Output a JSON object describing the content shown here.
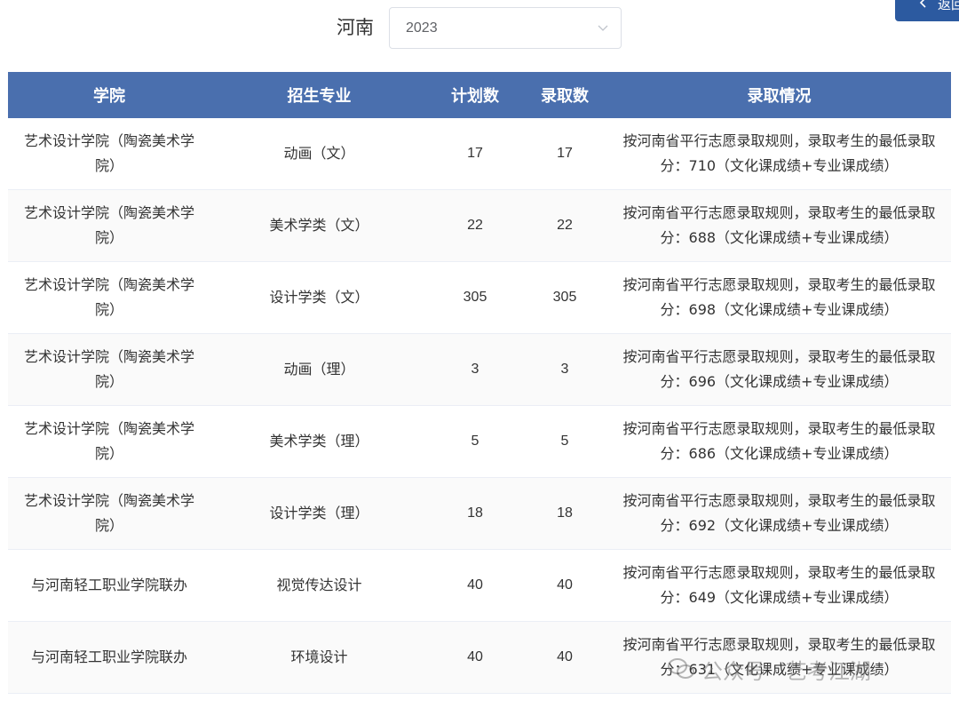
{
  "filter": {
    "province_label": "河南",
    "year_value": "2023"
  },
  "back_button": {
    "label": "返回"
  },
  "table": {
    "headers": {
      "college": "学院",
      "major": "招生专业",
      "plan": "计划数",
      "admitted": "录取数",
      "status": "录取情况"
    },
    "rows": [
      {
        "college": "艺术设计学院（陶瓷美术学院）",
        "major": "动画（文）",
        "plan": "17",
        "admitted": "17",
        "status": "按河南省平行志愿录取规则，录取考生的最低录取分：710（文化课成绩+专业课成绩）"
      },
      {
        "college": "艺术设计学院（陶瓷美术学院）",
        "major": "美术学类（文）",
        "plan": "22",
        "admitted": "22",
        "status": "按河南省平行志愿录取规则，录取考生的最低录取分：688（文化课成绩+专业课成绩）"
      },
      {
        "college": "艺术设计学院（陶瓷美术学院）",
        "major": "设计学类（文）",
        "plan": "305",
        "admitted": "305",
        "status": "按河南省平行志愿录取规则，录取考生的最低录取分：698（文化课成绩+专业课成绩）"
      },
      {
        "college": "艺术设计学院（陶瓷美术学院）",
        "major": "动画（理）",
        "plan": "3",
        "admitted": "3",
        "status": "按河南省平行志愿录取规则，录取考生的最低录取分：696（文化课成绩+专业课成绩）"
      },
      {
        "college": "艺术设计学院（陶瓷美术学院）",
        "major": "美术学类（理）",
        "plan": "5",
        "admitted": "5",
        "status": "按河南省平行志愿录取规则，录取考生的最低录取分：686（文化课成绩+专业课成绩）"
      },
      {
        "college": "艺术设计学院（陶瓷美术学院）",
        "major": "设计学类（理）",
        "plan": "18",
        "admitted": "18",
        "status": "按河南省平行志愿录取规则，录取考生的最低录取分：692（文化课成绩+专业课成绩）"
      },
      {
        "college": "与河南轻工职业学院联办",
        "major": "视觉传达设计",
        "plan": "40",
        "admitted": "40",
        "status": "按河南省平行志愿录取规则，录取考生的最低录取分：649（文化课成绩+专业课成绩）"
      },
      {
        "college": "与河南轻工职业学院联办",
        "major": "环境设计",
        "plan": "40",
        "admitted": "40",
        "status": "按河南省平行志愿录取规则，录取考生的最低录取分：631（文化课成绩+专业课成绩）"
      }
    ]
  },
  "watermark": {
    "text": "公众号 · 艺考江湖"
  }
}
